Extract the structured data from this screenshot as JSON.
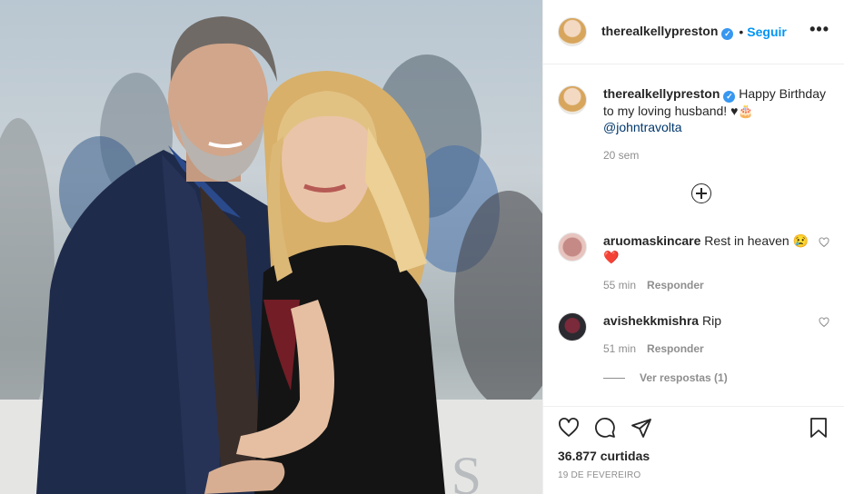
{
  "post": {
    "username": "therealkellypreston",
    "verified_mark": "✓",
    "separator": "•",
    "follow_label": "Seguir",
    "more_icon": "more-options-icon",
    "caption": {
      "username": "therealkellypreston",
      "text": "Happy Birthday to my loving husband! ♥",
      "emoji": "🎂",
      "mention": "@johntravolta",
      "time": "20 sem"
    }
  },
  "comments": [
    {
      "username": "aruomaskincare",
      "text": "Rest in heaven 😢",
      "extra": "❤️",
      "time": "55 min",
      "reply_label": "Responder"
    },
    {
      "username": "avishekkmishra",
      "text": "Rip",
      "time": "51 min",
      "reply_label": "Responder"
    }
  ],
  "view_replies": "Ver respostas (1)",
  "footer": {
    "likes": "36.877 curtidas",
    "date": "19 DE FEVEREIRO"
  },
  "photo": {
    "backdrop_text": "ES"
  },
  "colors": {
    "accent": "#0095f6",
    "verified": "#3897f0",
    "muted": "#8e8e8e",
    "text": "#262626",
    "heart": "#ed4956"
  }
}
